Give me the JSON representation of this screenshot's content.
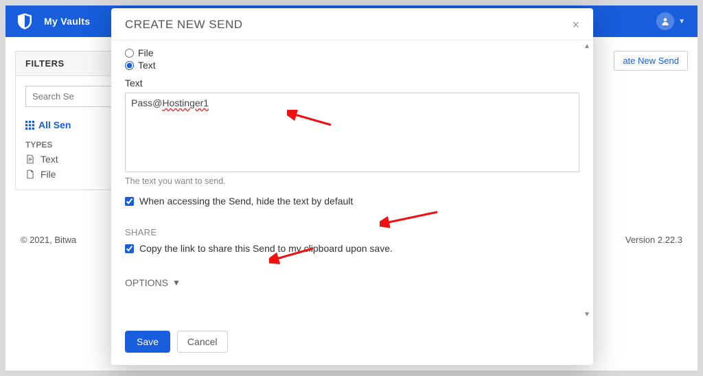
{
  "topbar": {
    "brand": "My Vaults"
  },
  "sidebar": {
    "filters_label": "FILTERS",
    "search_placeholder": "Search Se",
    "all_sends": "All Sen",
    "types_label": "TYPES",
    "type_text": "Text",
    "type_file": "File"
  },
  "main": {
    "create_btn": "ate New Send"
  },
  "footer": {
    "left": "© 2021, Bitwa",
    "right": "Version 2.22.3"
  },
  "modal": {
    "title": "CREATE NEW SEND",
    "radio_file": "File",
    "radio_text": "Text",
    "text_label": "Text",
    "text_value_plain": "Pass@",
    "text_value_err": "Hostinger1",
    "text_helper": "The text you want to send.",
    "hide_text_label": "When accessing the Send, hide the text by default",
    "share_label": "SHARE",
    "copy_link_label": "Copy the link to share this Send to my clipboard upon save.",
    "options_label": "OPTIONS",
    "save": "Save",
    "cancel": "Cancel"
  }
}
